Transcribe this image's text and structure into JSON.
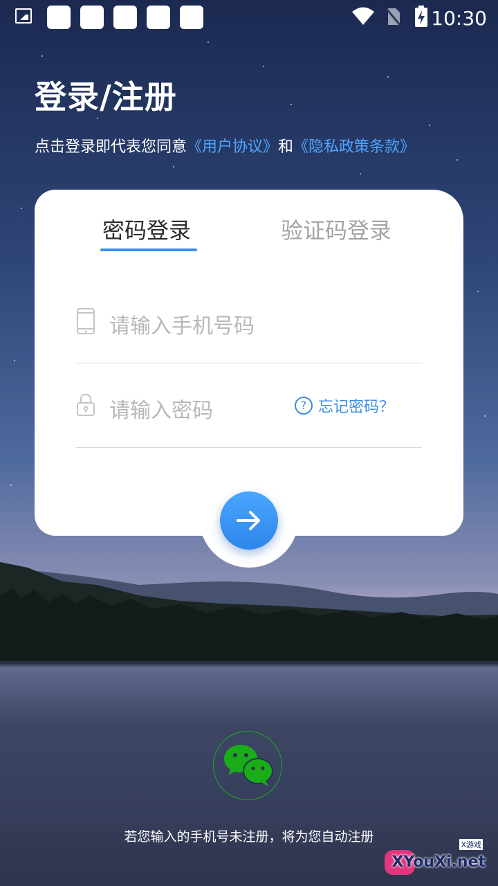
{
  "status_bar": {
    "time": "10:30",
    "icons": [
      "image-icon",
      "wifi-icon",
      "no-sim-icon",
      "battery-charging-icon"
    ]
  },
  "header": {
    "title": "登录/注册",
    "agreement_prefix": "点击登录即代表您同意",
    "user_agreement_link": "《用户协议》",
    "conjunction": "和",
    "privacy_link": "《隐私政策条款》"
  },
  "login_card": {
    "tabs": [
      {
        "label": "密码登录",
        "active": true
      },
      {
        "label": "验证码登录",
        "active": false
      }
    ],
    "phone_field": {
      "placeholder": "请输入手机号码",
      "icon": "phone-icon"
    },
    "password_field": {
      "placeholder": "请输入密码",
      "icon": "lock-icon"
    },
    "forgot_password": "忘记密码？",
    "submit_icon": "arrow-right-icon"
  },
  "footer": {
    "wechat_icon": "wechat-icon",
    "auto_register_note": "若您输入的手机号未注册，将为您自动注册"
  },
  "watermark": {
    "text": "XYouXi.net",
    "small": "X游戏"
  },
  "colors": {
    "accent": "#3b8ef0",
    "link": "#4fa6ff",
    "wechat_green": "#1aad19"
  }
}
